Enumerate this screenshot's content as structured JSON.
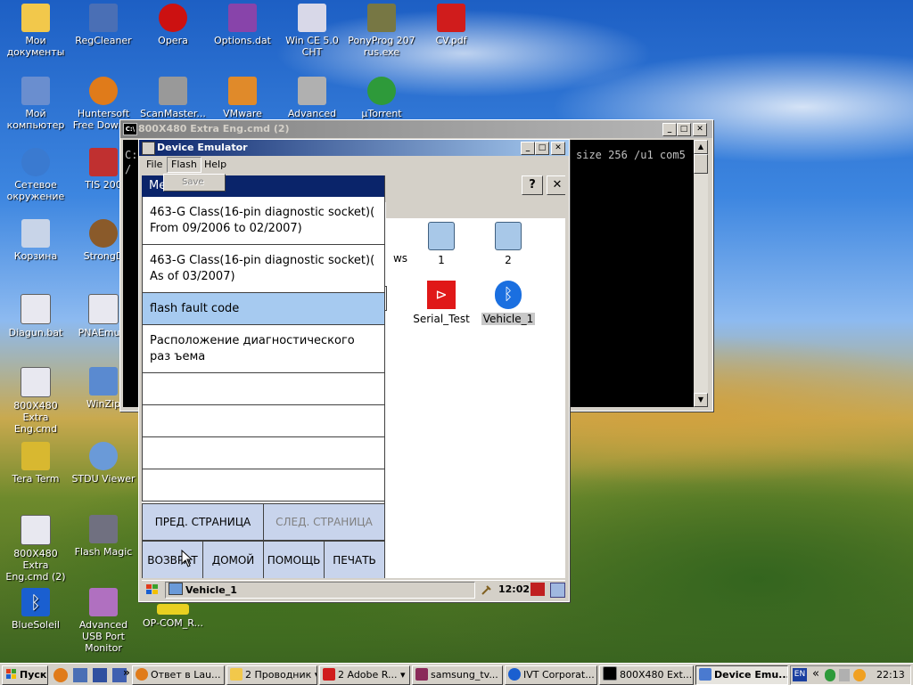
{
  "desktop_icons": [
    {
      "label": "Мои документы",
      "icon": "folder-icon",
      "color": "#f2c84b"
    },
    {
      "label": "RegCleaner",
      "icon": "regcleaner-icon",
      "color": "#4a6fb5"
    },
    {
      "label": "Opera",
      "icon": "opera-icon",
      "color": "#cc1111"
    },
    {
      "label": "Options.dat",
      "icon": "hex-file-icon",
      "color": "#8844aa"
    },
    {
      "label": "Win CE 5.0 CHT",
      "icon": "file-icon",
      "color": "#d8d8e8"
    },
    {
      "label": "PonyProg 207 rus.exe",
      "icon": "chip-icon",
      "color": "#777744"
    },
    {
      "label": "CV.pdf",
      "icon": "pdf-icon",
      "color": "#d01c1c"
    },
    {
      "label": "Мой компьютер",
      "icon": "computer-icon",
      "color": "#6a8ecf"
    },
    {
      "label": "Huntersoft Free Down...",
      "icon": "firefox-icon",
      "color": "#e07b1a"
    },
    {
      "label": "ScanMaster...",
      "icon": "scanner-icon",
      "color": "#999999"
    },
    {
      "label": "VMware",
      "icon": "vmware-icon",
      "color": "#e08a2a"
    },
    {
      "label": "Advanced",
      "icon": "app-icon",
      "color": "#b0b0b0"
    },
    {
      "label": "µTorrent",
      "icon": "utorrent-icon",
      "color": "#2e9a3a"
    },
    {
      "label": "Сетевое окружение",
      "icon": "network-icon",
      "color": "#3a7ad0"
    },
    {
      "label": "TIS 200",
      "icon": "app-icon",
      "color": "#c03030"
    },
    {
      "label": "Корзина",
      "icon": "recycle-bin-icon",
      "color": "#c8d4e8"
    },
    {
      "label": "StrongD",
      "icon": "app-icon",
      "color": "#8a5a2a"
    },
    {
      "label": "Diagun.bat",
      "icon": "batch-file-icon",
      "color": "#e8e8f0"
    },
    {
      "label": "PNAEmula",
      "icon": "batch-file-icon",
      "color": "#e8e8f0"
    },
    {
      "label": "800X480 Extra Eng.cmd",
      "icon": "batch-file-icon",
      "color": "#e8e8f0"
    },
    {
      "label": "WinZip",
      "icon": "winzip-icon",
      "color": "#5a8ad0"
    },
    {
      "label": "Tera Term",
      "icon": "teraterm-icon",
      "color": "#d8b830"
    },
    {
      "label": "STDU Viewer",
      "icon": "viewer-icon",
      "color": "#6a9ad8"
    },
    {
      "label": "800X480 Extra Eng.cmd (2)",
      "icon": "batch-file-icon",
      "color": "#e8e8f0"
    },
    {
      "label": "Flash Magic",
      "icon": "flashmagic-icon",
      "color": "#707080"
    },
    {
      "label": "BlueSoleil",
      "icon": "bluetooth-icon",
      "color": "#1a5fd0"
    },
    {
      "label": "Advanced USB Port Monitor",
      "icon": "usb-monitor-icon",
      "color": "#b070c0"
    },
    {
      "label": "OP-COM_R...",
      "icon": "opcom-icon",
      "color": "#e8d020"
    }
  ],
  "console": {
    "title": "800X480 Extra Eng.cmd (2)",
    "prompt": "C:",
    "line_right": "size 256 /u1 com5",
    "line2": "/"
  },
  "emulator": {
    "title": "Device Emulator",
    "menu": [
      "File",
      "Flash",
      "Help"
    ],
    "flash_menu_items": [
      "Save"
    ],
    "list_header": "Me",
    "list_items": [
      "463-G Class(16-pin diagnostic socket)( From 09/2006 to 02/2007)",
      "463-G Class(16-pin diagnostic socket)( As of 03/2007)",
      "flash fault code",
      "Расположение диагностического раз ъема",
      "",
      "",
      "",
      ""
    ],
    "prev_page": "ПРЕД. СТРАНИЦА",
    "next_page": "СЛЕД. СТРАНИЦА",
    "bottom_buttons": [
      "ВОЗВРАТ",
      "ДОМОЙ",
      "ПОМОЩЬ",
      "ПЕЧАТЬ"
    ],
    "help_glyph": "?",
    "close_glyph": "✕",
    "files": [
      {
        "label": "ws",
        "icon": "folder-icon"
      },
      {
        "label": "1",
        "icon": "computer-icon"
      },
      {
        "label": "2",
        "icon": "computer-icon"
      },
      {
        "label": "Serial_Test",
        "icon": "serial-test-icon"
      },
      {
        "label": "Vehicle_1",
        "icon": "bluetooth-icon"
      }
    ],
    "taskbar_item": "Vehicle_1",
    "clock": "12:02"
  },
  "taskbar": {
    "start": "Пуск",
    "chevron": "»",
    "items": [
      {
        "label": "Ответ в Lau...",
        "color": "#e07b1a"
      },
      {
        "label": "2 Проводник",
        "color": "#f2c84b"
      },
      {
        "label": "2 Adobe R...",
        "color": "#d01c1c"
      },
      {
        "label": "samsung_tv...",
        "color": "#8a2a5a"
      },
      {
        "label": "IVT Corporat...",
        "color": "#1a5fd0"
      },
      {
        "label": "800X480 Ext...",
        "color": "#000000"
      },
      {
        "label": "Device Emu...",
        "color": "#4a7ad0"
      }
    ],
    "lang": "EN",
    "tray_chevron": "«",
    "time": "22:13"
  }
}
